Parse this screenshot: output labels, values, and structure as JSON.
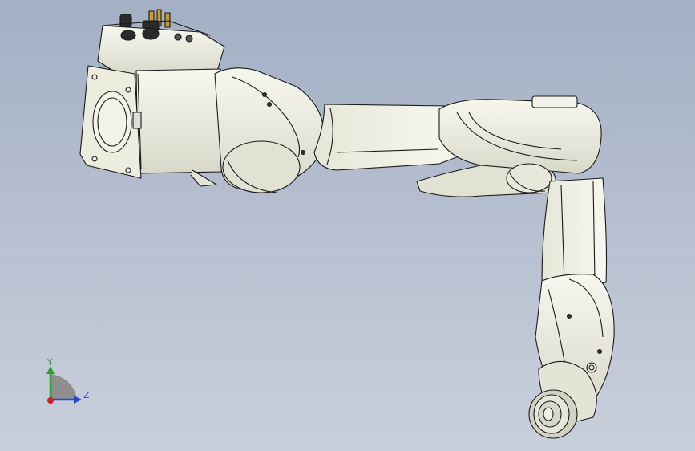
{
  "viewport": {
    "background_top": "#a3afc4",
    "background_bottom": "#c9d0dc",
    "model": "robot-arm-assembly",
    "part_fill": "#f0f0e6",
    "part_shade": "#d6d6c8",
    "edge_color": "#1a1a1a"
  },
  "triad": {
    "y_label": "Y",
    "z_label": "Z",
    "y_color": "#2e9e2e",
    "z_color": "#2646d8",
    "x_color": "#d02020"
  }
}
